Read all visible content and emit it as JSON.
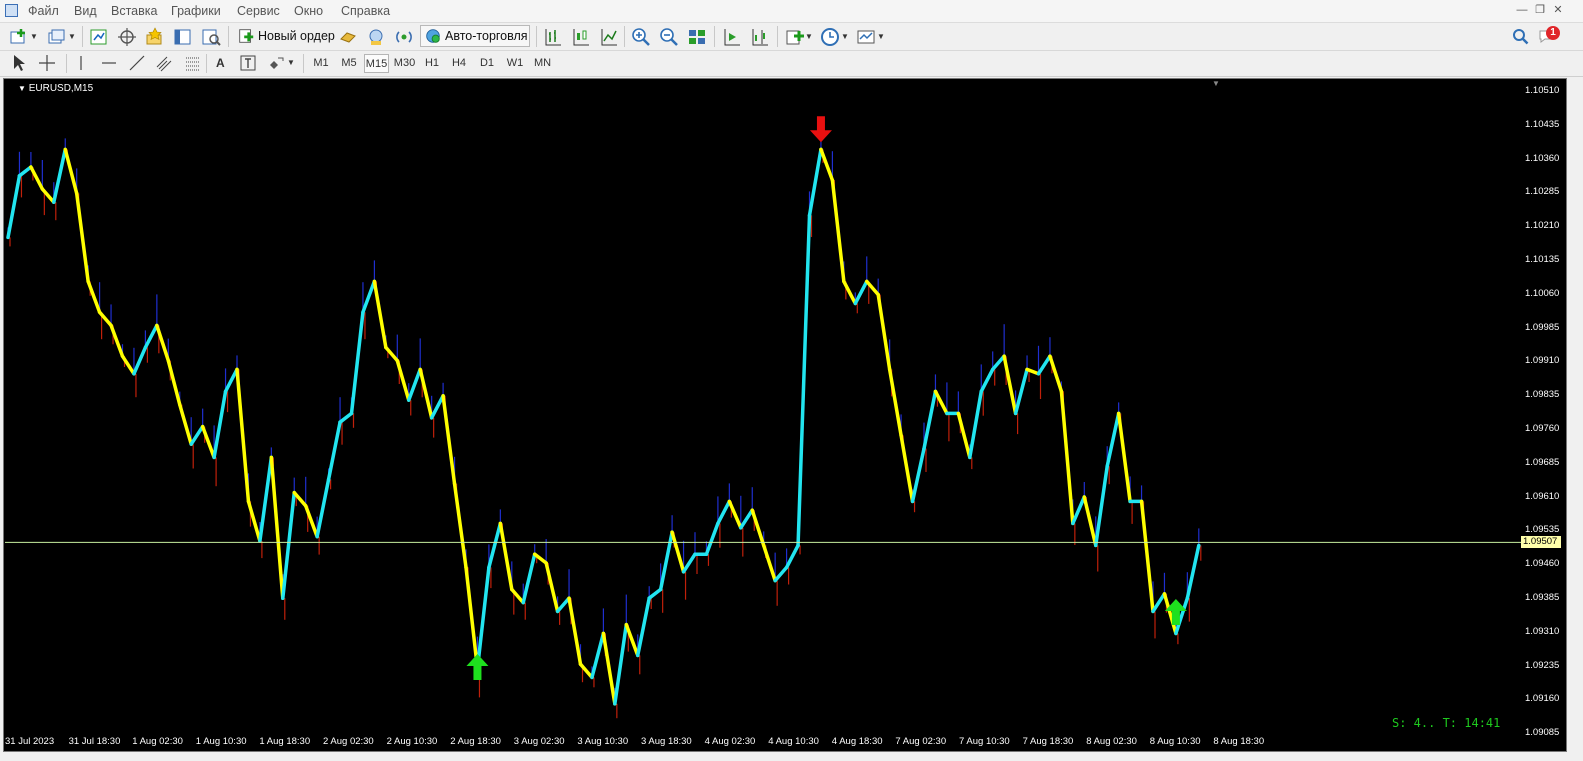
{
  "menu": {
    "items": [
      "Файл",
      "Вид",
      "Вставка",
      "Графики",
      "Сервис",
      "Окно",
      "Справка"
    ]
  },
  "toolbar": {
    "new_order": "Новый ордер",
    "auto_trading": "Авто-торговля",
    "notification_count": "1",
    "timeframes": [
      "M1",
      "M5",
      "M15",
      "M30",
      "H1",
      "H4",
      "D1",
      "W1",
      "MN"
    ],
    "active_timeframe": "M15"
  },
  "chart": {
    "symbol_label": "EURUSD,M15",
    "price_labels": [
      "1.10510",
      "1.10435",
      "1.10360",
      "1.10285",
      "1.10210",
      "1.10135",
      "1.10060",
      "1.09985",
      "1.09910",
      "1.09835",
      "1.09760",
      "1.09685",
      "1.09610",
      "1.09535",
      "1.09460",
      "1.09385",
      "1.09310",
      "1.09235",
      "1.09160",
      "1.09085"
    ],
    "current_price": "1.09507",
    "time_labels": [
      "31 Jul 2023",
      "31 Jul 18:30",
      "1 Aug 02:30",
      "1 Aug 10:30",
      "1 Aug 18:30",
      "2 Aug 02:30",
      "2 Aug 10:30",
      "2 Aug 18:30",
      "3 Aug 02:30",
      "3 Aug 10:30",
      "3 Aug 18:30",
      "4 Aug 02:30",
      "4 Aug 10:30",
      "4 Aug 18:30",
      "7 Aug 02:30",
      "7 Aug 10:30",
      "7 Aug 18:30",
      "8 Aug 02:30",
      "8 Aug 10:30",
      "8 Aug 18:30"
    ],
    "status_text": "S: 4.. T: 14:41",
    "colors": {
      "background": "#000000",
      "up_line": "#22e5f0",
      "down_line": "#ffff00",
      "wick_up": "#1f2fd0",
      "wick_down": "#c0200a",
      "bid_line": "#c8f0a0",
      "arrow_up": "#1ee01e",
      "arrow_down": "#e81010"
    }
  },
  "chart_data": {
    "type": "line",
    "title": "EURUSD,M15",
    "ylim": [
      1.09085,
      1.10535
    ],
    "series": [
      {
        "values": [
          1.102,
          1.1034,
          1.1036,
          1.1031,
          1.1028,
          1.104,
          1.103,
          1.101,
          1.1003,
          1.1,
          1.0993,
          1.0989,
          1.0995,
          1.1,
          1.0992,
          1.0982,
          1.0973,
          1.0977,
          1.097,
          1.0985,
          1.099,
          1.096,
          1.0951,
          1.097,
          1.0938,
          1.0962,
          1.0959,
          1.0952,
          1.0965,
          1.0978,
          1.098,
          1.1003,
          1.101,
          1.0995,
          1.0992,
          1.0983,
          1.099,
          1.0979,
          1.0984,
          1.0964,
          1.0945,
          1.0922,
          1.0945,
          1.0955,
          1.094,
          1.0937,
          1.0948,
          1.0946,
          1.0935,
          1.0938,
          1.0923,
          1.092,
          1.093,
          1.0914,
          1.0932,
          1.0925,
          1.0938,
          1.094,
          1.0953,
          1.0944,
          1.0948,
          1.0948,
          1.0955,
          1.096,
          1.0954,
          1.0958,
          1.095,
          1.0942,
          1.0945,
          1.095,
          1.1025,
          1.104,
          1.1033,
          1.101,
          1.1005,
          1.101,
          1.1007,
          1.099,
          1.0975,
          1.096,
          1.0972,
          1.0985,
          1.098,
          1.098,
          1.097,
          1.0985,
          1.099,
          1.0993,
          1.098,
          1.099,
          1.0989,
          1.0993,
          1.0985,
          1.0955,
          1.0961,
          1.095,
          1.0968,
          1.098,
          1.096,
          1.096,
          1.0935,
          1.0939,
          1.093,
          1.0938,
          1.095
        ]
      }
    ],
    "signals": [
      {
        "type": "buy",
        "index": 41,
        "price": 1.09235
      },
      {
        "type": "sell",
        "index": 71,
        "price": 1.1043
      },
      {
        "type": "buy",
        "index": 102,
        "price": 1.0936
      }
    ],
    "current_price": 1.09507
  }
}
